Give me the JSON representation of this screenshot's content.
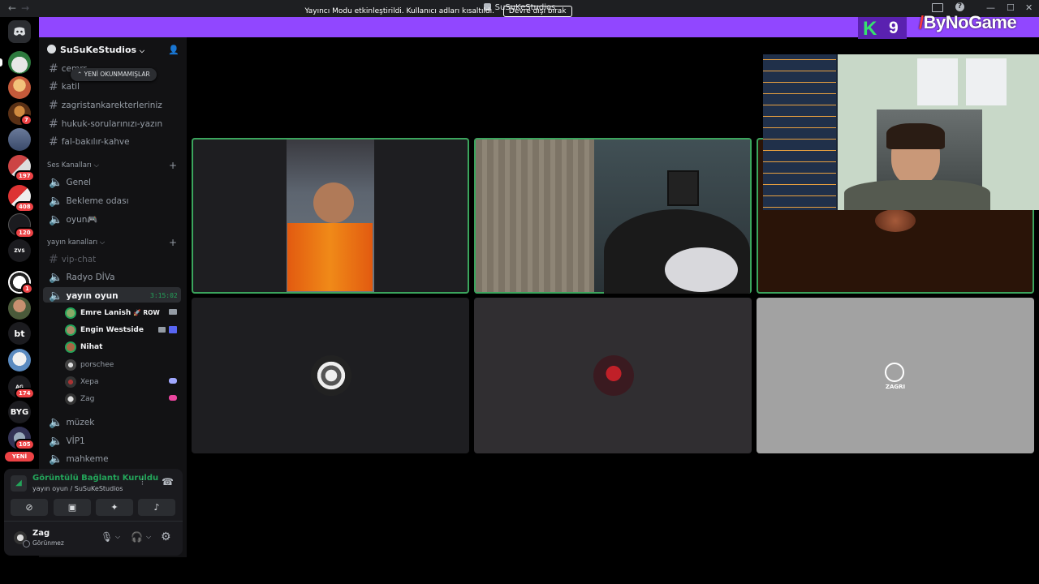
{
  "window": {
    "title": "SuSuKeStudios",
    "back_arrow": "←",
    "forward_arrow": "→",
    "minimize": "—",
    "maximize": "☐",
    "close": "✕"
  },
  "notice": {
    "text": "Yayıncı Modu etkinleştirildi. Kullanıcı adları kısaltıldı.",
    "button": "Devre dışı bırak"
  },
  "overlay": {
    "k_logo": "K",
    "k_number": "9",
    "brand": "ByNoGame"
  },
  "rail": {
    "badges": [
      "7",
      "197",
      "408",
      "120",
      "1",
      "174",
      "105"
    ],
    "text_servers": [
      "bt",
      "BYG",
      "ZVS",
      "AG"
    ],
    "new_label": "YENİ"
  },
  "server": {
    "name": "SuSuKeStudios",
    "unread_pill": "YENİ OKUNMAMIŞLAR",
    "text_channels": [
      "cemrr",
      "katil",
      "zagristankarekterleriniz",
      "hukuk-sorularınızı-yazın",
      "fal-bakılır-kahve"
    ],
    "voice_category": "Ses Kanalları",
    "voice_channels": [
      "Genel",
      "Bekleme odası",
      "oyun🎮"
    ],
    "stream_category": "yayın kanalları",
    "stream_channels": {
      "vip_chat": "vip-chat",
      "radyo": "Radyo DİVa",
      "active": "yayın oyun",
      "timer": "3:15:02"
    },
    "voice_users": [
      {
        "name": "Emre Lanish",
        "extra": "🚀 ROW"
      },
      {
        "name": "Engin Westside",
        "extra": ""
      },
      {
        "name": "Nihat",
        "extra": ""
      },
      {
        "name": "porschee",
        "extra": ""
      },
      {
        "name": "Xepa",
        "extra": ""
      },
      {
        "name": "Zag",
        "extra": ""
      }
    ],
    "more_channels": [
      "müzek",
      "VİP1",
      "mahkeme"
    ]
  },
  "voice_panel": {
    "status": "Görüntülü Bağlantı Kuruldu",
    "location": "yayın oyun / SuSuKeStudios"
  },
  "user": {
    "name": "Zag",
    "status": "Görünmez"
  },
  "tiles": {
    "zagri_label": "ZAGRI"
  },
  "colors": {
    "brand_purple": "#9147ff",
    "connected_green": "#23a55a",
    "speaking_border": "#3ba55d",
    "kick_green": "#35e26e",
    "badge_red": "#ed4245"
  }
}
